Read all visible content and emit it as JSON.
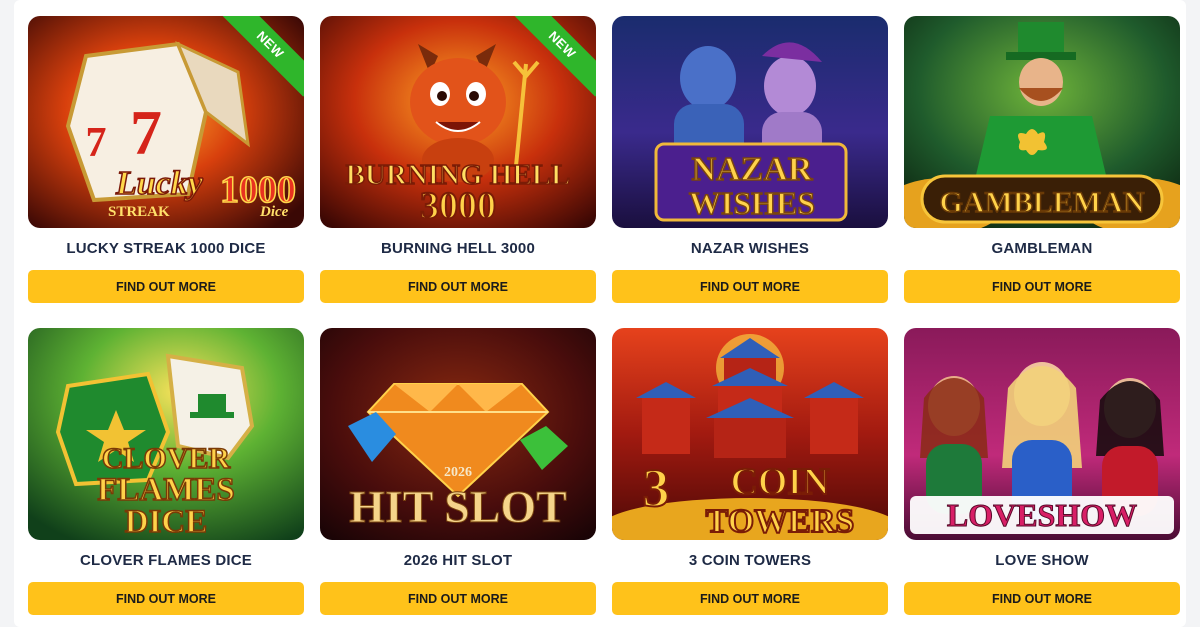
{
  "colors": {
    "button": "#ffc21a",
    "title_text": "#1e2a45",
    "new_ribbon": "#2fb62b"
  },
  "games": [
    {
      "title": "LUCKY STREAK 1000 DICE",
      "button": "FIND OUT MORE",
      "badge": "NEW",
      "art": {
        "line1": "Lucky",
        "line2": "1000",
        "line3": "STREAK",
        "line4": "Dice"
      }
    },
    {
      "title": "BURNING HELL 3000",
      "button": "FIND OUT MORE",
      "badge": "NEW",
      "art": {
        "line1": "BURNING HELL",
        "line2": "3000"
      }
    },
    {
      "title": "NAZAR WISHES",
      "button": "FIND OUT MORE",
      "badge": "",
      "art": {
        "line1": "NAZAR",
        "line2": "WISHES"
      }
    },
    {
      "title": "GAMBLEMAN",
      "button": "FIND OUT MORE",
      "badge": "",
      "art": {
        "line1": "GAMBLEMAN"
      }
    },
    {
      "title": "CLOVER FLAMES DICE",
      "button": "FIND OUT MORE",
      "badge": "",
      "art": {
        "line1": "CLOVER",
        "line2": "FLAMES",
        "line3": "DICE"
      }
    },
    {
      "title": "2026 HIT SLOT",
      "button": "FIND OUT MORE",
      "badge": "",
      "art": {
        "line1": "2026",
        "line2": "HIT SLOT"
      }
    },
    {
      "title": "3 COIN TOWERS",
      "button": "FIND OUT MORE",
      "badge": "",
      "art": {
        "line1": "3",
        "line2": "COIN",
        "line3": "TOWERS"
      }
    },
    {
      "title": "LOVE SHOW",
      "button": "FIND OUT MORE",
      "badge": "",
      "art": {
        "line1": "LOVESHOW"
      }
    }
  ]
}
